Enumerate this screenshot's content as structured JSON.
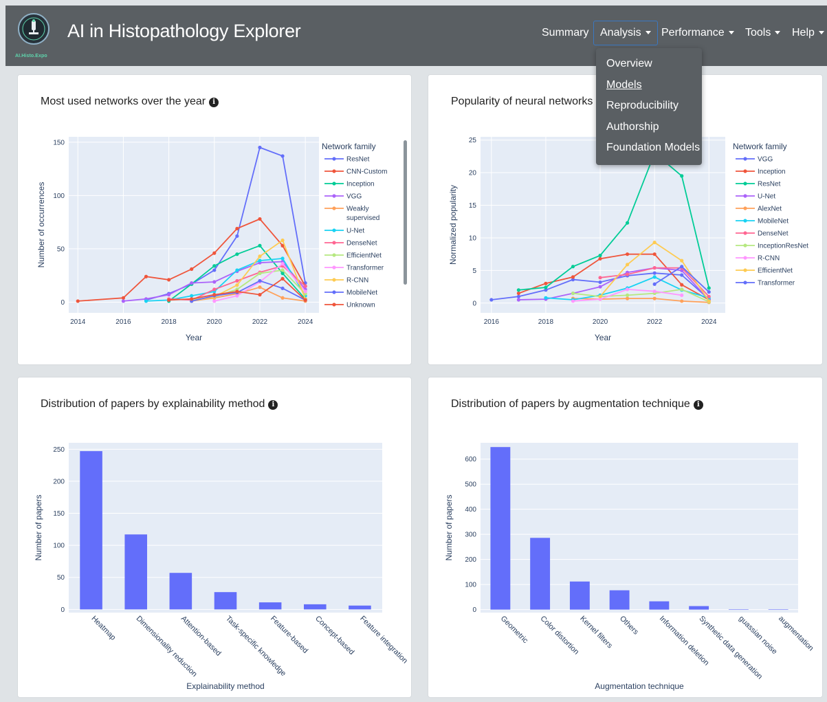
{
  "app": {
    "title": "AI in Histopathology Explorer",
    "logo_text": "AI.Histo.Expo"
  },
  "nav": {
    "items": [
      {
        "label": "Summary",
        "dropdown": false
      },
      {
        "label": "Analysis",
        "dropdown": true,
        "active": true
      },
      {
        "label": "Performance",
        "dropdown": true
      },
      {
        "label": "Tools",
        "dropdown": true
      },
      {
        "label": "Help",
        "dropdown": true
      }
    ],
    "analysis_menu": [
      "Overview",
      "Models",
      "Reproducibility",
      "Authorship",
      "Foundation Models"
    ],
    "analysis_menu_selected": "Models"
  },
  "cards": {
    "c1_title": "Most used networks over the year",
    "c2_title": "Popularity of neural networks by",
    "c3_title": "Distribution of papers by explainability method",
    "c4_title": "Distribution of papers by augmentation technique"
  },
  "chart_data": [
    {
      "type": "line",
      "xlabel": "Year",
      "ylabel": "Number of occurrences",
      "xlim": [
        2013.6,
        2024.6
      ],
      "ylim": [
        -10,
        155
      ],
      "xticks": [
        2014,
        2016,
        2018,
        2020,
        2022,
        2024
      ],
      "yticks": [
        0,
        50,
        100,
        150
      ],
      "legend_title": "Network family",
      "legend_position": "right",
      "series": [
        {
          "name": "ResNet",
          "color": "#636efa",
          "x": [
            2017,
            2018,
            2019,
            2020,
            2021,
            2022,
            2023,
            2024
          ],
          "y": [
            2,
            8,
            17,
            30,
            62,
            145,
            137,
            18
          ]
        },
        {
          "name": "CNN-Custom",
          "color": "#ef553b",
          "x": [
            2014,
            2016,
            2017,
            2018,
            2019,
            2020,
            2021,
            2022,
            2023,
            2024
          ],
          "y": [
            1,
            4,
            24,
            21,
            31,
            46,
            69,
            78,
            53,
            15
          ]
        },
        {
          "name": "Inception",
          "color": "#00cc96",
          "x": [
            2018,
            2019,
            2020,
            2021,
            2022,
            2023,
            2024
          ],
          "y": [
            1,
            17,
            34,
            45,
            53,
            27,
            3
          ]
        },
        {
          "name": "VGG",
          "color": "#ab63fa",
          "x": [
            2016,
            2017,
            2018,
            2019,
            2020,
            2021,
            2022,
            2023,
            2024
          ],
          "y": [
            1,
            3,
            7,
            18,
            19,
            29,
            37,
            38,
            12
          ]
        },
        {
          "name": "Weakly supervised",
          "color": "#ffa15a",
          "x": [
            2019,
            2020,
            2021,
            2022,
            2023,
            2024
          ],
          "y": [
            1,
            4,
            8,
            14,
            4,
            1
          ]
        },
        {
          "name": "U-Net",
          "color": "#19d3f3",
          "x": [
            2017,
            2018,
            2019,
            2020,
            2021,
            2022,
            2023,
            2024
          ],
          "y": [
            1,
            2,
            6,
            10,
            30,
            39,
            41,
            6
          ]
        },
        {
          "name": "DenseNet",
          "color": "#ff6692",
          "x": [
            2018,
            2019,
            2020,
            2021,
            2022,
            2023,
            2024
          ],
          "y": [
            3,
            2,
            12,
            20,
            28,
            34,
            15
          ]
        },
        {
          "name": "EfficientNet",
          "color": "#b6e880",
          "x": [
            2019,
            2020,
            2021,
            2022,
            2023,
            2024
          ],
          "y": [
            2,
            5,
            12,
            27,
            30,
            8
          ]
        },
        {
          "name": "Transformer",
          "color": "#ff97ff",
          "x": [
            2020,
            2021,
            2022,
            2023,
            2024
          ],
          "y": [
            1,
            6,
            19,
            36,
            10
          ]
        },
        {
          "name": "R-CNN",
          "color": "#fecb52",
          "x": [
            2019,
            2020,
            2021,
            2022,
            2023,
            2024
          ],
          "y": [
            1,
            5,
            16,
            43,
            58,
            3
          ]
        },
        {
          "name": "MobileNet",
          "color": "#636efa",
          "x": [
            2019,
            2020,
            2021,
            2022,
            2023,
            2024
          ],
          "y": [
            1,
            6,
            9,
            20,
            13,
            2
          ]
        },
        {
          "name": "Unknown",
          "color": "#ef553b",
          "x": [
            2018,
            2019,
            2020,
            2021,
            2022,
            2023,
            2024
          ],
          "y": [
            2,
            3,
            7,
            10,
            7,
            22,
            2
          ]
        }
      ]
    },
    {
      "type": "line",
      "xlabel": "Year",
      "ylabel": "Normalized popularity",
      "xlim": [
        2015.6,
        2024.6
      ],
      "ylim": [
        -1.5,
        25.5
      ],
      "xticks": [
        2016,
        2018,
        2020,
        2022,
        2024
      ],
      "yticks": [
        0,
        5,
        10,
        15,
        20,
        25
      ],
      "legend_title": "Network family",
      "legend_position": "right",
      "series": [
        {
          "name": "VGG",
          "color": "#636efa",
          "x": [
            2016,
            2017,
            2018,
            2019,
            2020,
            2021,
            2022,
            2023,
            2024
          ],
          "y": [
            0.5,
            1,
            2,
            3.6,
            3.2,
            4.2,
            4.6,
            4.3,
            0.6
          ]
        },
        {
          "name": "Inception",
          "color": "#ef553b",
          "x": [
            2017,
            2018,
            2019,
            2020,
            2021,
            2022,
            2023,
            2024
          ],
          "y": [
            1.5,
            3,
            4,
            6.8,
            7.5,
            7.5,
            2.8,
            0.5
          ]
        },
        {
          "name": "ResNet",
          "color": "#00cc96",
          "x": [
            2017,
            2018,
            2019,
            2020,
            2021,
            2022,
            2023,
            2024
          ],
          "y": [
            2,
            2.4,
            5.6,
            7.3,
            12.3,
            23,
            19.5,
            2.3
          ]
        },
        {
          "name": "U-Net",
          "color": "#ab63fa",
          "x": [
            2017,
            2018,
            2019,
            2020,
            2021,
            2022,
            2023,
            2024
          ],
          "y": [
            0.5,
            0.6,
            1.5,
            2.5,
            4.7,
            5.4,
            5,
            0.5
          ]
        },
        {
          "name": "AlexNet",
          "color": "#ffa15a",
          "x": [
            2019,
            2020,
            2021,
            2022,
            2023,
            2024
          ],
          "y": [
            0.7,
            0.6,
            0.7,
            0.7,
            0.3,
            0.1
          ]
        },
        {
          "name": "MobileNet",
          "color": "#19d3f3",
          "x": [
            2018,
            2019,
            2020,
            2021,
            2022,
            2023,
            2024
          ],
          "y": [
            0.8,
            0.5,
            1.2,
            2.3,
            4,
            2,
            0.8
          ]
        },
        {
          "name": "DenseNet",
          "color": "#ff6692",
          "x": [
            2020,
            2021,
            2022,
            2023,
            2024
          ],
          "y": [
            3.9,
            4.4,
            5.4,
            5.4,
            1
          ]
        },
        {
          "name": "InceptionResNet",
          "color": "#b6e880",
          "x": [
            2019,
            2020,
            2021,
            2022,
            2023,
            2024
          ],
          "y": [
            1.5,
            1,
            1.2,
            1.5,
            2.1,
            0.2
          ]
        },
        {
          "name": "R-CNN",
          "color": "#ff97ff",
          "x": [
            2019,
            2020,
            2021,
            2022,
            2023
          ],
          "y": [
            0.3,
            0.6,
            2.1,
            1.8,
            1.2
          ]
        },
        {
          "name": "EfficientNet",
          "color": "#fecb52",
          "x": [
            2020,
            2021,
            2022,
            2023,
            2024
          ],
          "y": [
            1,
            5.9,
            9.3,
            6.5,
            0.3
          ]
        },
        {
          "name": "Transformer",
          "color": "#636efa",
          "x": [
            2022,
            2023,
            2024
          ],
          "y": [
            2.9,
            5.6,
            1.7
          ]
        }
      ]
    },
    {
      "type": "bar",
      "xlabel": "Explainability method",
      "ylabel": "Number of papers",
      "ylim": [
        -5,
        260
      ],
      "yticks": [
        0,
        50,
        100,
        150,
        200,
        250
      ],
      "color": "#636efa",
      "categories": [
        "Heatmap",
        "Dimensionality reduction",
        "Attention-based",
        "Task-specific knowledge",
        "Feature-based",
        "Concept-based",
        "Feature integration"
      ],
      "values": [
        247,
        117,
        57,
        27,
        11,
        8,
        6
      ]
    },
    {
      "type": "bar",
      "xlabel": "Augmentation technique",
      "ylabel": "Number of papers",
      "ylim": [
        -12,
        665
      ],
      "yticks": [
        0,
        100,
        200,
        300,
        400,
        500,
        600
      ],
      "color": "#636efa",
      "categories": [
        "Geometric",
        "Color distortion",
        "Kernel filters",
        "Others",
        "Information deletion",
        "Synthetic data generation",
        "guassian noise",
        "augmentation"
      ],
      "values": [
        648,
        286,
        112,
        77,
        33,
        14,
        1,
        1
      ]
    }
  ]
}
